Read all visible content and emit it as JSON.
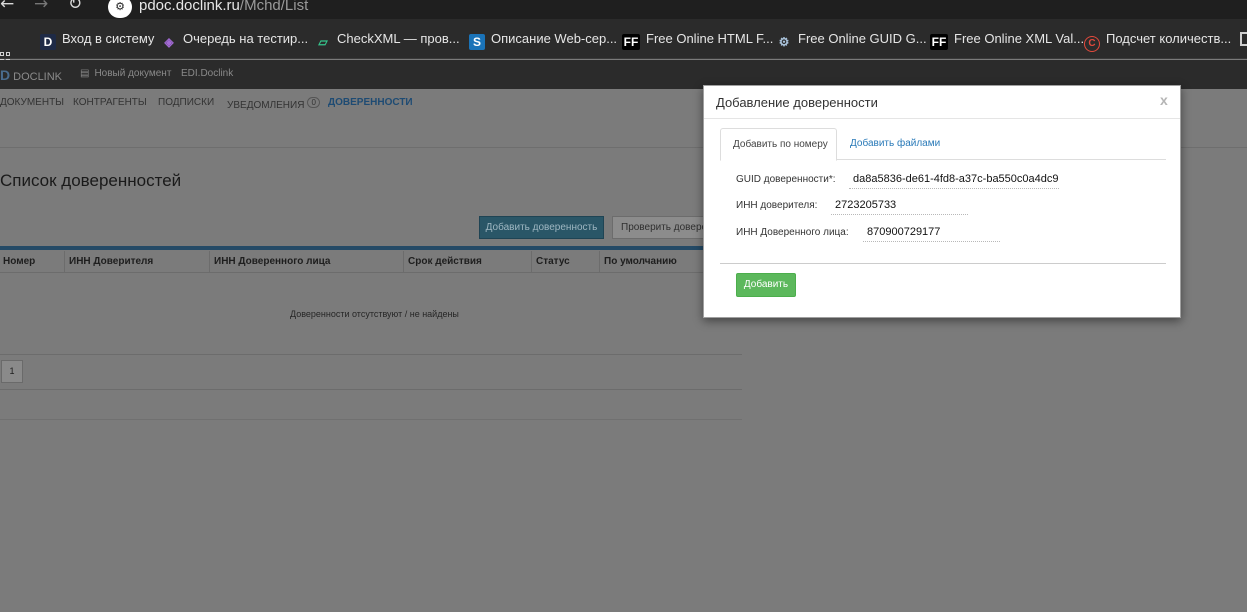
{
  "browser": {
    "url_host": "pdoc.doclink.ru",
    "url_path": "/Mchd/List",
    "site_icon_glyph": "⚙",
    "bookmarks": [
      {
        "label": "Вход в систему",
        "icon": "D",
        "icon_bg": "#1e2a46",
        "icon_color": "#ffffff"
      },
      {
        "label": "Очередь на тестир...",
        "icon": "◈",
        "icon_bg": "transparent",
        "icon_color": "#a36ad6"
      },
      {
        "label": "CheckXML — пров...",
        "icon": "▱",
        "icon_bg": "transparent",
        "icon_color": "#35c28a"
      },
      {
        "label": "Описание Web-сер...",
        "icon": "S",
        "icon_bg": "#1a73b8",
        "icon_color": "#ffffff"
      },
      {
        "label": "Free Online HTML F...",
        "icon": "FF",
        "icon_bg": "#000000",
        "icon_color": "#ffffff"
      },
      {
        "label": "Free Online GUID G...",
        "icon": "⚙",
        "icon_bg": "transparent",
        "icon_color": "#a9c2da"
      },
      {
        "label": "Free Online XML Val...",
        "icon": "FF",
        "icon_bg": "#000000",
        "icon_color": "#ffffff"
      },
      {
        "label": "Подсчет количеств...",
        "icon": "C",
        "icon_bg": "transparent",
        "icon_color": "#e2493c"
      }
    ]
  },
  "app": {
    "logo": "DOCLINK",
    "new_doc": "Новый документ",
    "edi": "EDI.Doclink",
    "nav": [
      {
        "label": "ДОКУМЕНТЫ"
      },
      {
        "label": "КОНТРАГЕНТЫ"
      },
      {
        "label": "ПОДПИСКИ"
      },
      {
        "label": "УВЕДОМЛЕНИЯ",
        "count": "0"
      },
      {
        "label": "ДОВЕРЕННОСТИ",
        "active": true
      }
    ],
    "list_title": "Список доверенностей",
    "add_proxy_button": "Добавить доверенность",
    "check_proxy_button": "Проверить доверенность",
    "table": {
      "columns": [
        "Номер",
        "ИНН Доверителя",
        "ИНН Доверенного лица",
        "Срок действия",
        "Статус",
        "По умолчанию"
      ],
      "empty_message": "Доверенности отсутствуют / не найдены"
    },
    "pagination": {
      "current_page": "1"
    }
  },
  "modal": {
    "title": "Добавление доверенности",
    "close": "x",
    "tabs": [
      {
        "label": "Добавить по номеру",
        "active": true
      },
      {
        "label": "Добавить файлами",
        "active": false
      }
    ],
    "fields": {
      "guid_label": "GUID доверенности*:",
      "guid_value": "da8a5836-de61-4fd8-a37c-ba550c0a4dc9",
      "principal_inn_label": "ИНН доверителя:",
      "principal_inn_value": "2723205733",
      "agent_inn_label": "ИНН Доверенного лица:",
      "agent_inn_value": "870900729177"
    },
    "submit_button": "Добавить",
    "colors": {
      "submit": "#5cb85c",
      "tab_link": "#2a7ab8"
    }
  }
}
